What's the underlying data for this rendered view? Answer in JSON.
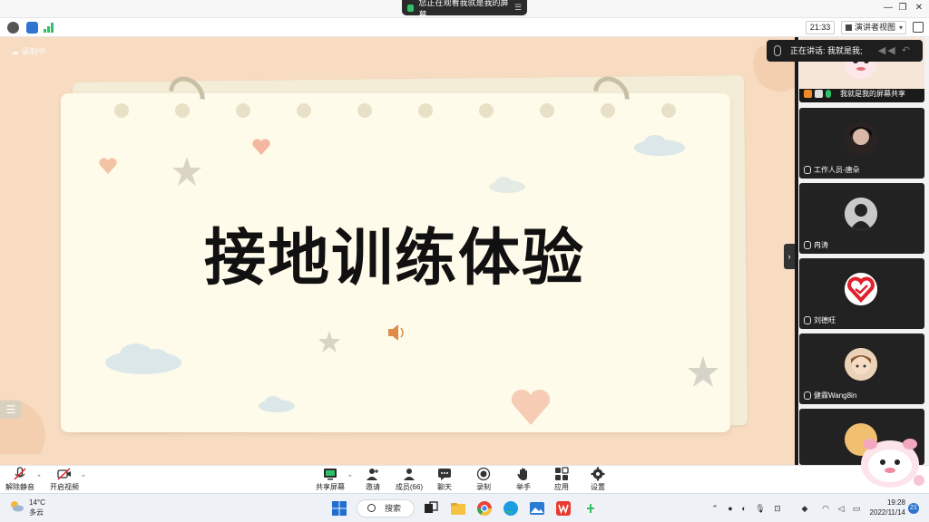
{
  "top_bar": {
    "share_banner": "您正在观看我就是我的屏幕",
    "menu_icon": "menu-icon"
  },
  "info_bar": {
    "clock": "21:33",
    "view_mode": "演讲者视图"
  },
  "stage": {
    "recording_label": "录制中",
    "slide_title": "接地训练体验"
  },
  "right_panel": {
    "speaking_now": "正在讲话: 我就是我;",
    "participants": [
      {
        "name": "我就是我的屏幕共享",
        "avatar": "cartoon-avatar"
      },
      {
        "name": "工作人员-唐朵",
        "avatar": "photo-avatar"
      },
      {
        "name": "冉涛",
        "avatar": "dark-figure-avatar"
      },
      {
        "name": "刘德旺",
        "avatar": "heart-avatar"
      },
      {
        "name": "健霖Wang8in",
        "avatar": "anime-avatar"
      }
    ]
  },
  "toolbar": {
    "unmute": "解除静音",
    "start_video": "开启视频",
    "share_screen": "共享屏幕",
    "invite": "邀请",
    "members": "成员(66)",
    "chat": "聊天",
    "record": "录制",
    "raise_hand": "举手",
    "apps": "应用",
    "settings": "设置"
  },
  "taskbar": {
    "weather_temp": "14°C",
    "weather_desc": "多云",
    "search": "搜索",
    "time": "19:28",
    "date": "2022/11/14",
    "notifications": "21"
  },
  "colors": {
    "stage_bg": "#f7dcc2",
    "paper": "#fffbea",
    "accent_green": "#2ec16a",
    "tile_bg": "#222222"
  }
}
